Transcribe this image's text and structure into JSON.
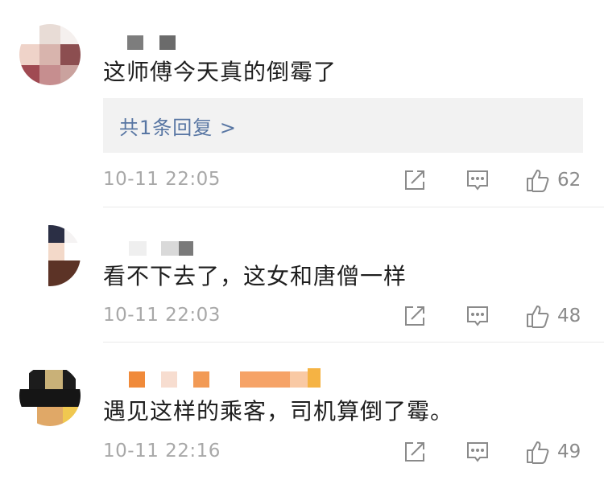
{
  "comments": [
    {
      "text": "这师傅今天真的倒霉了",
      "replies_label": "共1条回复 >",
      "time": "10-11 22:05",
      "likes": "62"
    },
    {
      "text": "看不下去了，这女和唐僧一样",
      "time": "10-11 22:03",
      "likes": "48"
    },
    {
      "text": "遇见这样的乘客，司机算倒了霉。",
      "time": "10-11 22:16",
      "likes": "49"
    }
  ],
  "icons": {
    "share": "share-icon",
    "comment": "comment-icon",
    "like": "thumbs-up-icon"
  },
  "colors": {
    "link": "#5876a3",
    "meta": "#a8a8a8",
    "reply_bg": "#f2f2f2",
    "icon": "#8a8a8a"
  }
}
